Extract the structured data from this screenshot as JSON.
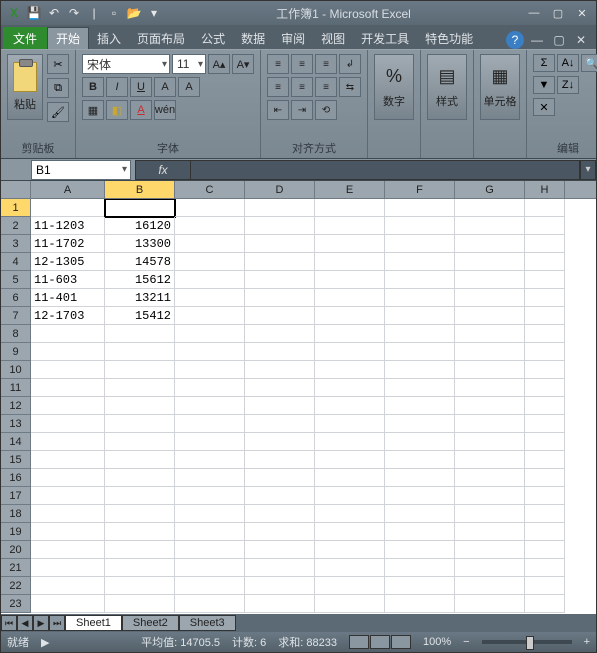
{
  "title": "工作簿1 - Microsoft Excel",
  "tabs": {
    "file": "文件",
    "items": [
      "开始",
      "插入",
      "页面布局",
      "公式",
      "数据",
      "审阅",
      "视图",
      "开发工具",
      "特色功能"
    ],
    "active": 0
  },
  "ribbon": {
    "clipboard": {
      "paste": "粘贴",
      "label": "剪贴板"
    },
    "font": {
      "name": "宋体",
      "size": "11",
      "label": "字体"
    },
    "align": {
      "label": "对齐方式"
    },
    "number": {
      "btn": "数字",
      "pct": "%"
    },
    "styles": {
      "btn": "样式"
    },
    "cells": {
      "btn": "单元格"
    },
    "editing": {
      "label": "编辑"
    }
  },
  "formula_bar": {
    "namebox": "B1",
    "fx": "fx"
  },
  "columns": [
    "A",
    "B",
    "C",
    "D",
    "E",
    "F",
    "G",
    "H"
  ],
  "row_count": 23,
  "selected_cell": {
    "row": 1,
    "col": 1
  },
  "cells": {
    "A2": "11-1203",
    "B2": "16120",
    "A3": "11-1702",
    "B3": "13300",
    "A4": "12-1305",
    "B4": "14578",
    "A5": "11-603",
    "B5": "15612",
    "A6": "11-401",
    "B6": "13211",
    "A7": "12-1703",
    "B7": "15412"
  },
  "sheets": {
    "items": [
      "Sheet1",
      "Sheet2",
      "Sheet3"
    ],
    "active": 0
  },
  "status": {
    "mode": "就绪",
    "avg_lbl": "平均值:",
    "avg": "14705.5",
    "cnt_lbl": "计数:",
    "cnt": "6",
    "sum_lbl": "求和:",
    "sum": "88233",
    "zoom": "100%"
  },
  "chart_data": null
}
